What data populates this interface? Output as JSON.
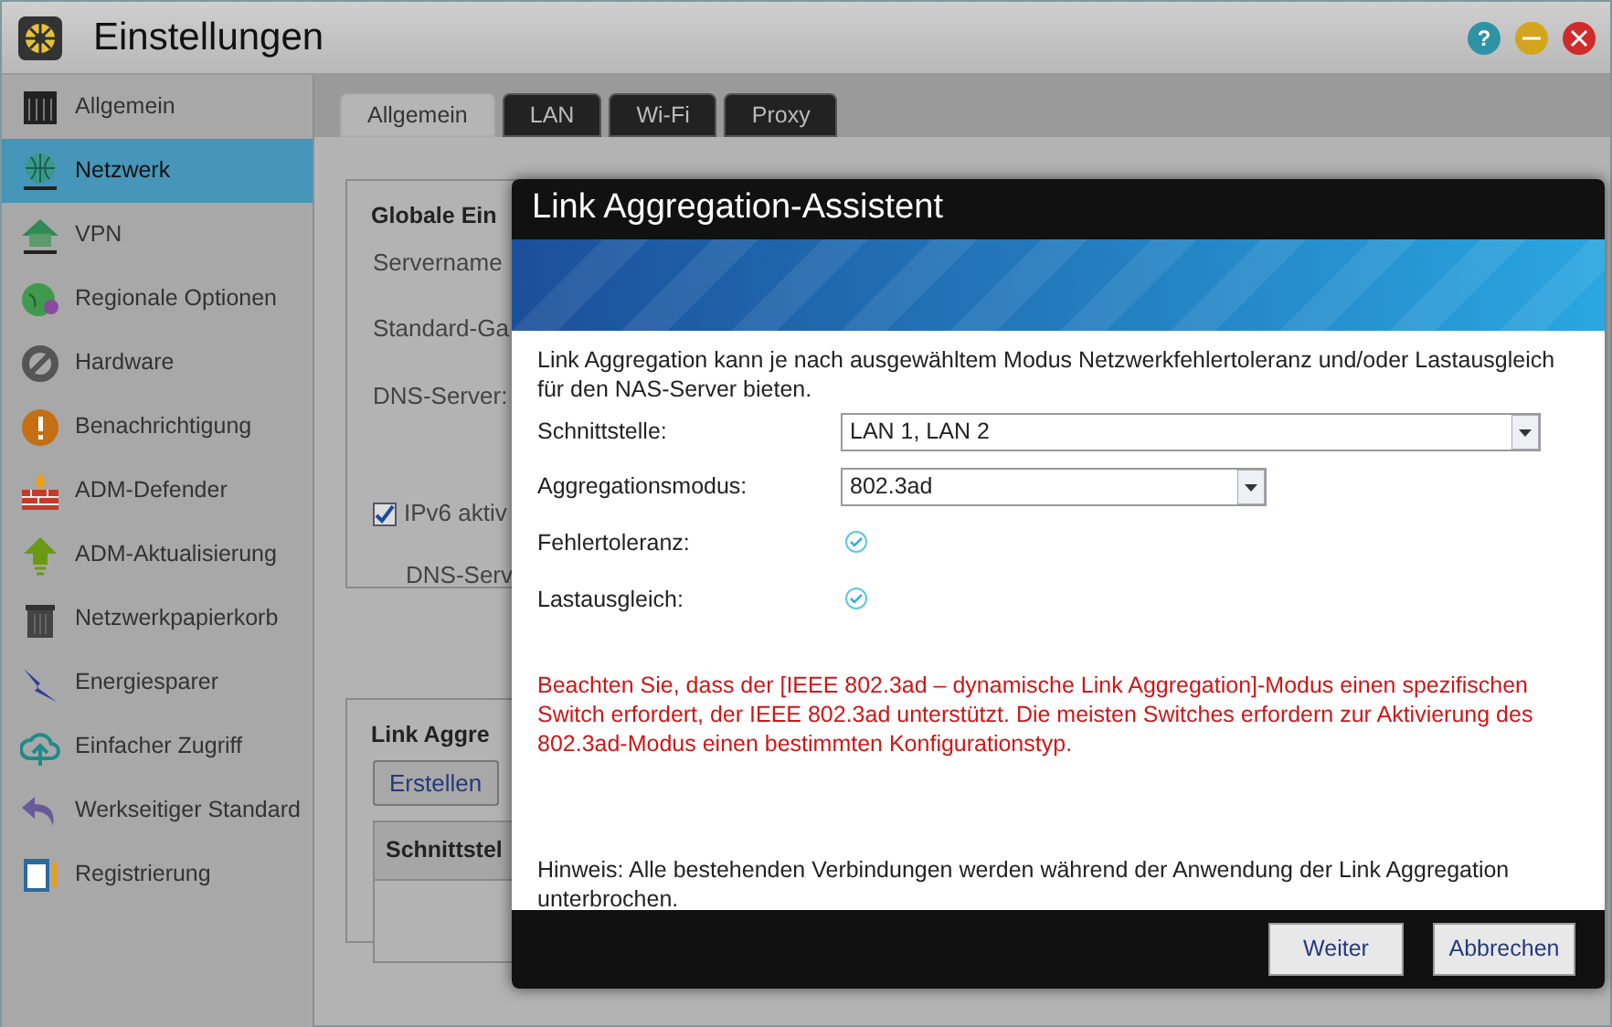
{
  "window": {
    "title": "Einstellungen",
    "help": "?"
  },
  "sidebar": {
    "items": [
      {
        "label": "Allgemein",
        "selected": false
      },
      {
        "label": "Netzwerk",
        "selected": true
      },
      {
        "label": "VPN",
        "selected": false
      },
      {
        "label": "Regionale Optionen",
        "selected": false
      },
      {
        "label": "Hardware",
        "selected": false
      },
      {
        "label": "Benachrichtigung",
        "selected": false
      },
      {
        "label": "ADM-Defender",
        "selected": false
      },
      {
        "label": "ADM-Aktualisierung",
        "selected": false
      },
      {
        "label": "Netzwerkpapierkorb",
        "selected": false
      },
      {
        "label": "Energiesparer",
        "selected": false
      },
      {
        "label": "Einfacher Zugriff",
        "selected": false
      },
      {
        "label": "Werkseitiger Standard",
        "selected": false
      },
      {
        "label": "Registrierung",
        "selected": false
      }
    ]
  },
  "tabs": [
    {
      "label": "Allgemein",
      "selected": true
    },
    {
      "label": "LAN",
      "selected": false
    },
    {
      "label": "Wi-Fi",
      "selected": false
    },
    {
      "label": "Proxy",
      "selected": false
    }
  ],
  "global_settings": {
    "legend": "Globale Ein",
    "fields": [
      "Servername",
      "Standard-Ga",
      "DNS-Server:"
    ],
    "ipv6": {
      "label": "IPv6 aktiv",
      "checked": true
    },
    "dns_label": "DNS-Serv"
  },
  "link_aggregation": {
    "legend": "Link Aggre",
    "button": "Erstellen",
    "column_1": "Schnittstel"
  },
  "dialog": {
    "title": "Link Aggregation-Assistent",
    "intro": "Link Aggregation kann je nach ausgewähltem Modus Netzwerkfehlertoleranz und/oder Lastausgleich für den NAS-Server bieten.",
    "fields": [
      {
        "kind": "select",
        "label": "Schnittstelle:",
        "value": "LAN 1, LAN 2",
        "wide": true
      },
      {
        "kind": "select",
        "label": "Aggregationsmodus:",
        "value": "802.3ad",
        "wide": false
      },
      {
        "kind": "check",
        "label": "Fehlertoleranz:",
        "checked": true
      },
      {
        "kind": "check",
        "label": "Lastausgleich:",
        "checked": true
      }
    ],
    "warning": "Beachten Sie, dass der [IEEE 802.3ad – dynamische Link Aggregation]-Modus einen spezifischen Switch erfordert, der IEEE 802.3ad unterstützt. Die meisten Switches erfordern zur Aktivierung des 802.3ad-Modus einen bestimmten Konfigurationstyp.",
    "note": "Hinweis: Alle bestehenden Verbindungen werden während der Anwendung der Link Aggregation unterbrochen.",
    "buttons": [
      "Weiter",
      "Abbrechen"
    ]
  }
}
